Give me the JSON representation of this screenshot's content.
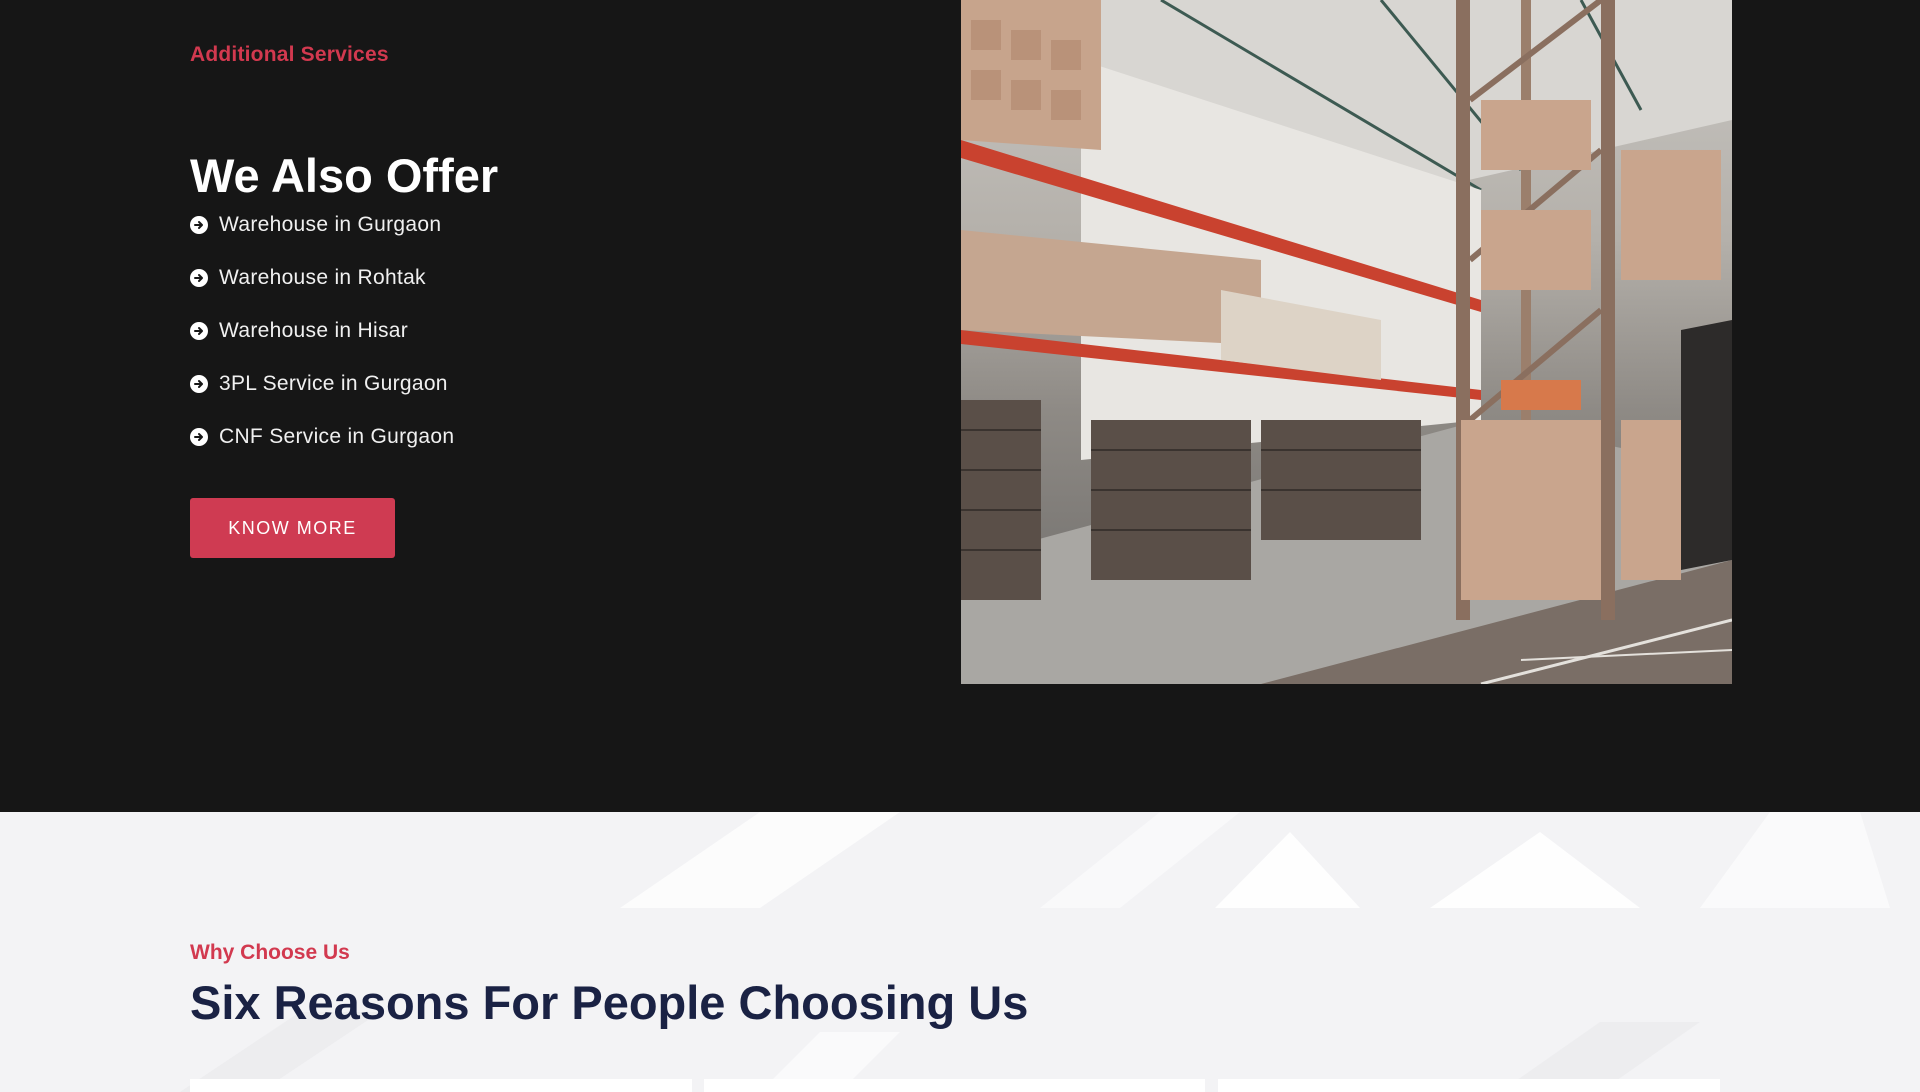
{
  "services": {
    "eyebrow": "Additional Services",
    "title": "We Also Offer",
    "items": [
      "Warehouse in Gurgaon",
      "Warehouse in Rohtak",
      "Warehouse in Hisar",
      "3PL Service in Gurgaon",
      "CNF Service in Gurgaon"
    ],
    "cta_label": "KNOW MORE",
    "accent_color": "#cf3b52",
    "item_icon": "circle-arrow-right-icon"
  },
  "why": {
    "eyebrow": "Why Choose Us",
    "title": "Six Reasons For People Choosing Us"
  },
  "colors": {
    "dark_background": "#161616",
    "light_background": "#f3f3f5",
    "accent": "#d2394f",
    "navy": "#1a2244"
  }
}
